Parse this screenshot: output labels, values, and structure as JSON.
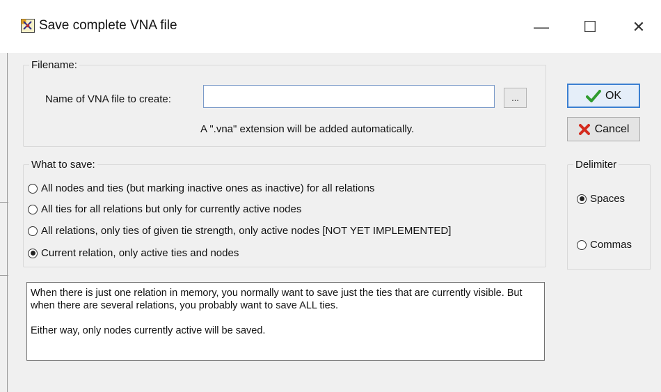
{
  "window": {
    "title": "Save complete VNA file",
    "controls": {
      "minimize": "—",
      "maximize": "☐",
      "close": "✕"
    }
  },
  "filename_group": {
    "legend": "Filename:",
    "name_label": "Name of VNA file to create:",
    "name_value": "",
    "browse_label": "...",
    "note": "A \".vna\" extension will be added automatically."
  },
  "buttons": {
    "ok": "OK",
    "cancel": "Cancel"
  },
  "what_to_save": {
    "legend": "What to save:",
    "options": [
      {
        "label": "All nodes and ties (but marking inactive ones as inactive) for all relations",
        "selected": false
      },
      {
        "label": "All ties for all relations but only for currently active nodes",
        "selected": false
      },
      {
        "label": "All relations, only ties of given tie strength, only active nodes [NOT YET IMPLEMENTED]",
        "selected": false
      },
      {
        "label": "Current relation, only active ties and nodes",
        "selected": true
      }
    ]
  },
  "delimiter": {
    "legend": "Delimiter",
    "options": [
      {
        "label": "Spaces",
        "selected": true
      },
      {
        "label": "Commas",
        "selected": false
      }
    ]
  },
  "info": {
    "line1": "When there is just one relation in memory, you normally want to save just the ties that are currently visible. But when there are several relations, you probably want to save ALL ties.",
    "line2": "Either way, only nodes currently active will be saved."
  },
  "icons": {
    "app": "vna-app-icon",
    "ok": "green-check-icon",
    "cancel": "red-x-icon"
  },
  "colors": {
    "accent": "#3b7fd1",
    "check": "#2e9b2e",
    "cancel_x": "#d42b1e"
  }
}
